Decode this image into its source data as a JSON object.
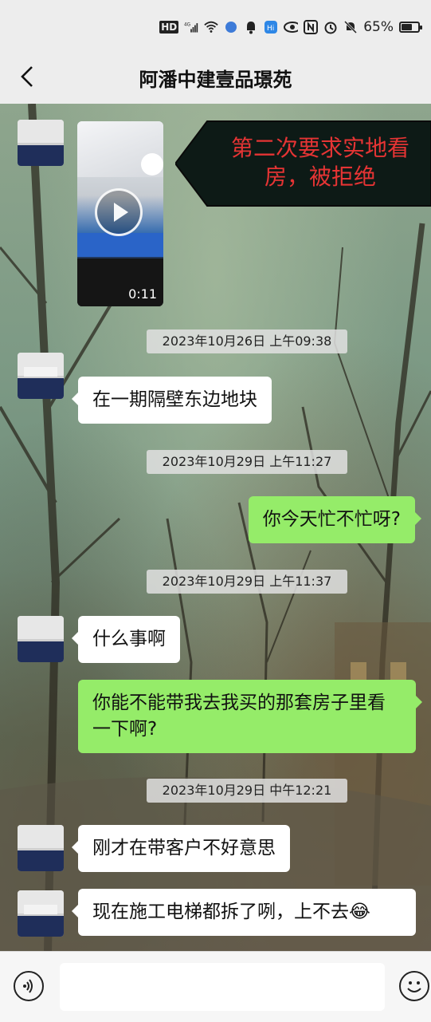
{
  "status_bar": {
    "network_label": "HD",
    "signal_label": "4G",
    "battery_text": "65%",
    "battery_level_percent": 65,
    "icons": [
      "hd-icon",
      "signal-icon",
      "wifi-icon",
      "app-badge-icon",
      "notification-icon",
      "eye-icon",
      "nfc-icon",
      "alarm-icon",
      "mute-icon",
      "battery-icon"
    ]
  },
  "header": {
    "title": "阿潘中建壹品璟苑",
    "back_icon": "chevron-left-icon"
  },
  "annotation": {
    "text": "第二次要求实地看房，被拒绝",
    "color": "#e53434"
  },
  "video": {
    "duration": "0:11",
    "play_icon": "play-icon"
  },
  "messages": [
    {
      "type": "time",
      "text": "2023年10月26日 上午09:38"
    },
    {
      "type": "in",
      "text": "在一期隔壁东边地块"
    },
    {
      "type": "time",
      "text": "2023年10月29日 上午11:27"
    },
    {
      "type": "out",
      "text": "你今天忙不忙呀?"
    },
    {
      "type": "time",
      "text": "2023年10月29日 上午11:37"
    },
    {
      "type": "in",
      "text": "什么事啊"
    },
    {
      "type": "out",
      "text": "你能不能带我去我买的那套房子里看一下啊?"
    },
    {
      "type": "time",
      "text": "2023年10月29日 中午12:21"
    },
    {
      "type": "in",
      "text": "刚才在带客户不好意思"
    },
    {
      "type": "in",
      "text": "现在施工电梯都拆了咧，上不去"
    }
  ],
  "emoji_in_last_message": "😂",
  "input_bar": {
    "placeholder": "",
    "voice_icon": "voice-icon",
    "emoji_icon": "emoji-icon"
  },
  "colors": {
    "incoming_bubble": "#ffffff",
    "outgoing_bubble": "#95ec69",
    "header_background": "#ededed"
  }
}
